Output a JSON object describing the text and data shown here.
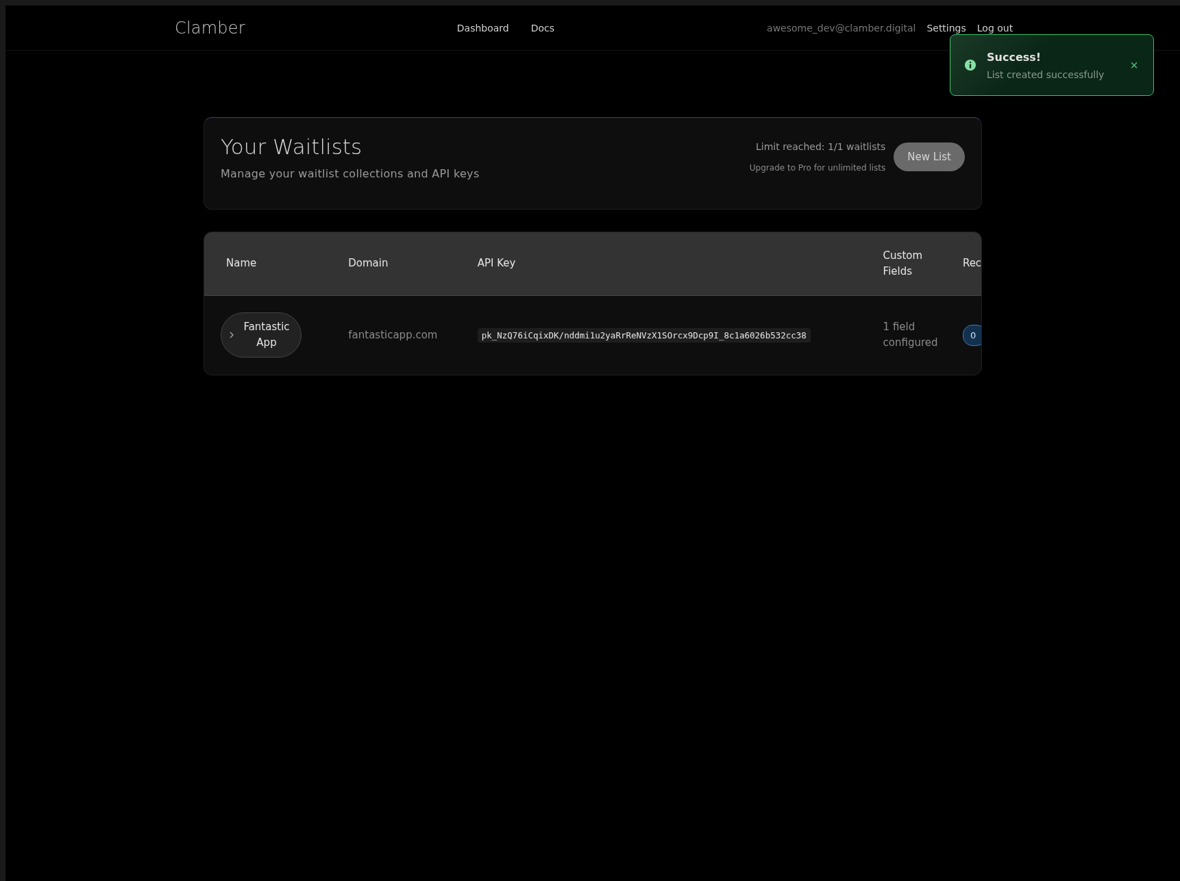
{
  "header": {
    "logo": "Clamber",
    "nav": [
      {
        "label": "Dashboard"
      },
      {
        "label": "Docs"
      }
    ],
    "user_email": "awesome_dev@clamber.digital",
    "links": [
      {
        "label": "Settings"
      },
      {
        "label": "Log out"
      }
    ]
  },
  "toast": {
    "kind": "success",
    "title": "Success!",
    "message": "List created successfully",
    "close": "×"
  },
  "waitlists": {
    "title": "Your Waitlists",
    "subtitle": "Manage your waitlist collections and API keys",
    "limit": "Limit reached: 1/1 waitlists",
    "upgrade": "Upgrade to Pro for unlimited lists",
    "new_button": {
      "label": "New List",
      "disabled": true
    }
  },
  "table": {
    "columns": [
      "Name",
      "Domain",
      "API Key",
      "Custom Fields",
      "Rec"
    ],
    "rows": [
      {
        "name": "Fantastic App",
        "expanded": false,
        "domain": "fantasticapp.com",
        "api_key": "pk_NzQ76iCqixDK/nddmi1u2yaRrReNVzX1SOrcx9Dcp9I_8c1a6026b532cc38",
        "custom_fields": "1 field configured",
        "column_5": "0"
      }
    ]
  }
}
